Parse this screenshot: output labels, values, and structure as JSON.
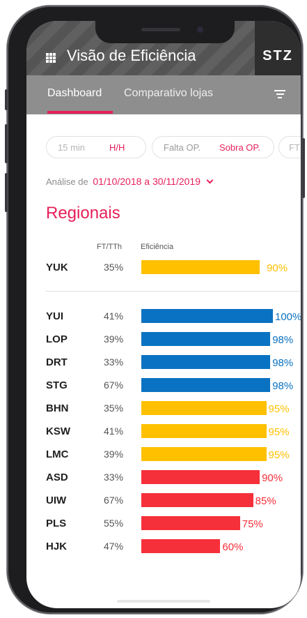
{
  "header": {
    "title": "Visão de Eficiência",
    "brand": "STZ",
    "menu_icon": "grid-menu-icon"
  },
  "tabs": [
    {
      "label": "Dashboard",
      "active": true
    },
    {
      "label": "Comparativo lojas",
      "active": false
    }
  ],
  "filters": {
    "time": {
      "options": [
        "15 min",
        "H/H"
      ],
      "selected": "H/H"
    },
    "op": {
      "options": [
        "Falta OP.",
        "Sobra OP."
      ],
      "selected": "Sobra OP."
    },
    "extra": "FT"
  },
  "period": {
    "label": "Análise de",
    "range": "01/10/2018 a 30/11/2019"
  },
  "section_title": "Regionais",
  "columns": {
    "ft": "FT/TTh",
    "efficiency": "Eficiência"
  },
  "colors": {
    "accent": "#e6205a",
    "blue": "#0a72c2",
    "yellow": "#ffc000",
    "red": "#f5303a"
  },
  "summary_row": {
    "name": "YUK",
    "ft": "35%",
    "efficiency": 90,
    "label": "90%",
    "tone": "yellow"
  },
  "rows": [
    {
      "name": "YUI",
      "ft": "41%",
      "efficiency": 100,
      "label": "100%",
      "tone": "blue"
    },
    {
      "name": "LOP",
      "ft": "39%",
      "efficiency": 98,
      "label": "98%",
      "tone": "blue"
    },
    {
      "name": "DRT",
      "ft": "33%",
      "efficiency": 98,
      "label": "98%",
      "tone": "blue"
    },
    {
      "name": "STG",
      "ft": "67%",
      "efficiency": 98,
      "label": "98%",
      "tone": "blue"
    },
    {
      "name": "BHN",
      "ft": "35%",
      "efficiency": 95,
      "label": "95%",
      "tone": "yellow"
    },
    {
      "name": "KSW",
      "ft": "41%",
      "efficiency": 95,
      "label": "95%",
      "tone": "yellow"
    },
    {
      "name": "LMC",
      "ft": "39%",
      "efficiency": 95,
      "label": "95%",
      "tone": "yellow"
    },
    {
      "name": "ASD",
      "ft": "33%",
      "efficiency": 90,
      "label": "90%",
      "tone": "red"
    },
    {
      "name": "UIW",
      "ft": "67%",
      "efficiency": 85,
      "label": "85%",
      "tone": "red"
    },
    {
      "name": "PLS",
      "ft": "55%",
      "efficiency": 75,
      "label": "75%",
      "tone": "red"
    },
    {
      "name": "HJK",
      "ft": "47%",
      "efficiency": 60,
      "label": "60%",
      "tone": "red"
    }
  ]
}
